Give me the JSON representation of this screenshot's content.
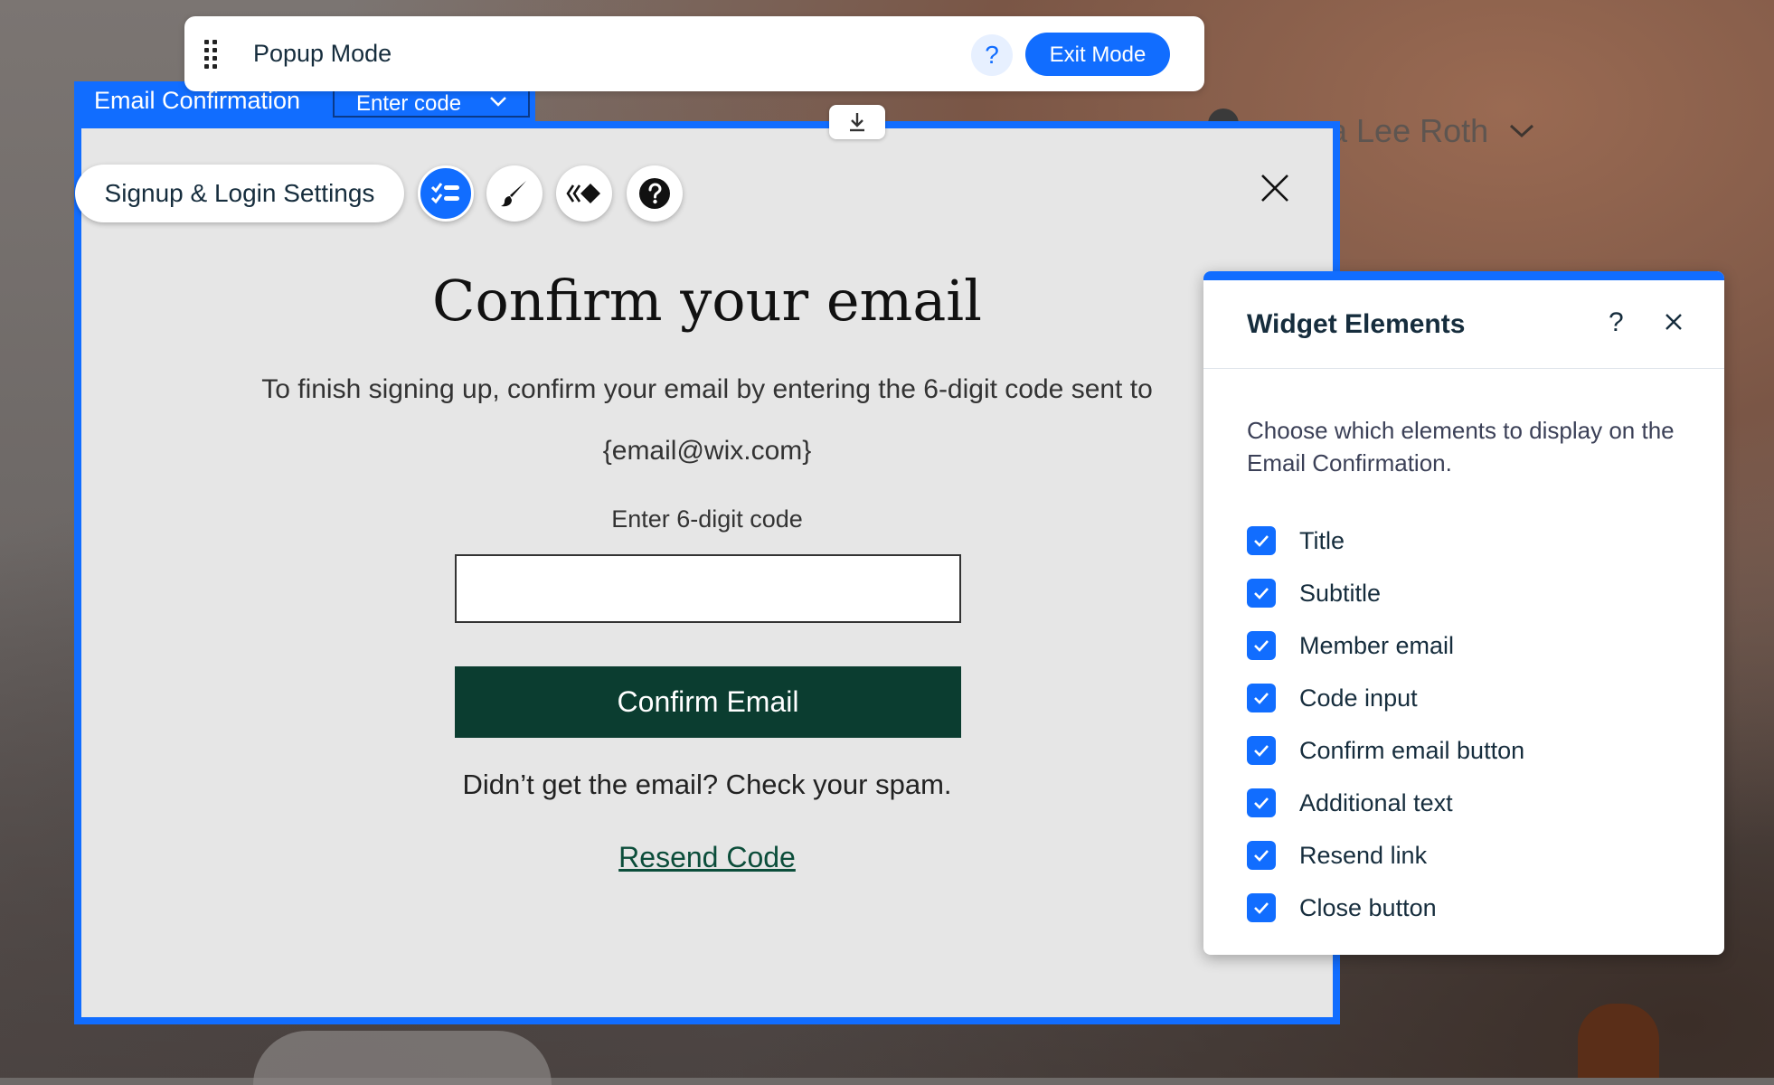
{
  "topbar": {
    "title": "Popup Mode",
    "help": "?",
    "exit_label": "Exit Mode"
  },
  "component": {
    "name": "Email Confirmation",
    "state": "Enter code"
  },
  "background": {
    "member_name_fragment": "a Lee Roth"
  },
  "toolbar": {
    "settings_label": "Signup & Login Settings",
    "tools": [
      "elements-icon",
      "design-brush-icon",
      "animation-icon",
      "help-icon"
    ]
  },
  "popup": {
    "title": "Confirm your email",
    "subtitle": "To finish signing up, confirm your email by entering the 6-digit code sent to",
    "email": "{email@wix.com}",
    "code_label": "Enter 6-digit code",
    "code_value": "",
    "confirm_label": "Confirm Email",
    "additional_text": "Didn’t get the email? Check your spam.",
    "resend_label": "Resend Code"
  },
  "panel": {
    "title": "Widget Elements",
    "help": "?",
    "description": "Choose which elements to display on the Email Confirmation.",
    "items": [
      {
        "label": "Title",
        "checked": true
      },
      {
        "label": "Subtitle",
        "checked": true
      },
      {
        "label": "Member email",
        "checked": true
      },
      {
        "label": "Code input",
        "checked": true
      },
      {
        "label": "Confirm email button",
        "checked": true
      },
      {
        "label": "Additional text",
        "checked": true
      },
      {
        "label": "Resend link",
        "checked": true
      },
      {
        "label": "Close button",
        "checked": true
      }
    ]
  },
  "colors": {
    "accent": "#116dff",
    "confirm_button": "#0b3d30",
    "popup_bg": "#e6e6e6"
  }
}
